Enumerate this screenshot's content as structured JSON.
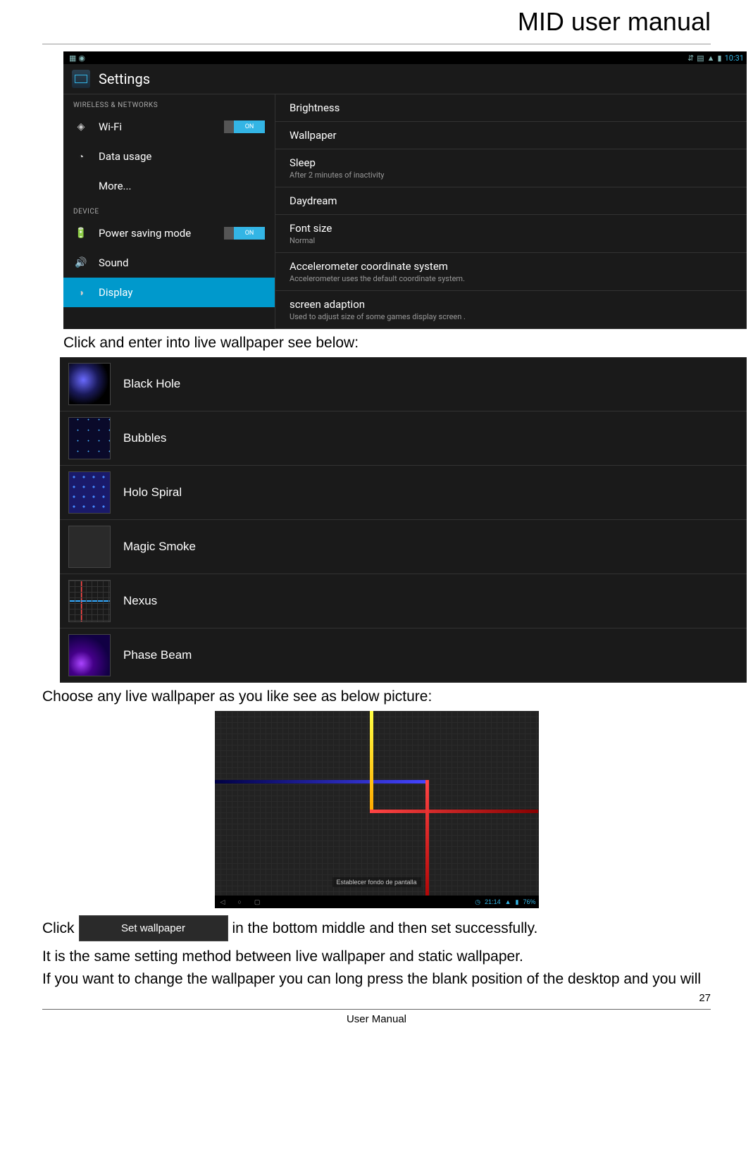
{
  "header": "MID user manual",
  "status": {
    "time": "10:31",
    "wifi_icon": "▲",
    "battery_icon": "▮"
  },
  "settings": {
    "title": "Settings",
    "sections": {
      "wireless": "WIRELESS & NETWORKS",
      "device": "DEVICE"
    },
    "left_items": {
      "wifi": "Wi-Fi",
      "wifi_toggle": "ON",
      "data": "Data usage",
      "more": "More...",
      "power": "Power saving mode",
      "power_toggle": "ON",
      "sound": "Sound",
      "display": "Display"
    },
    "right_items": {
      "brightness": {
        "title": "Brightness"
      },
      "wallpaper": {
        "title": "Wallpaper"
      },
      "sleep": {
        "title": "Sleep",
        "sub": "After 2 minutes of inactivity"
      },
      "daydream": {
        "title": "Daydream"
      },
      "font": {
        "title": "Font size",
        "sub": "Normal"
      },
      "accel": {
        "title": "Accelerometer coordinate system",
        "sub": "Accelerometer uses the default coordinate system."
      },
      "adapt": {
        "title": "screen adaption",
        "sub": "Used to adjust size of some games display screen ."
      }
    }
  },
  "text1": "Click and enter into live wallpaper see below:",
  "wallpapers": {
    "items": [
      "Black Hole",
      "Bubbles",
      "Holo Spiral",
      "Magic Smoke",
      "Nexus",
      "Phase Beam"
    ]
  },
  "text2": "Choose any live wallpaper as you like see as below picture:",
  "preview": {
    "center_label": "Establecer fondo de pantalla",
    "time": "21:14",
    "battery": "76%"
  },
  "click_line": {
    "before": "Click",
    "button": "Set wallpaper",
    "after": "in the bottom middle and then set successfully."
  },
  "text3": "It is the same setting method between live wallpaper and static wallpaper.",
  "text4": "If you want to change the wallpaper you can long press the blank position of the desktop and you will",
  "footer": "User Manual",
  "page_num": "27"
}
